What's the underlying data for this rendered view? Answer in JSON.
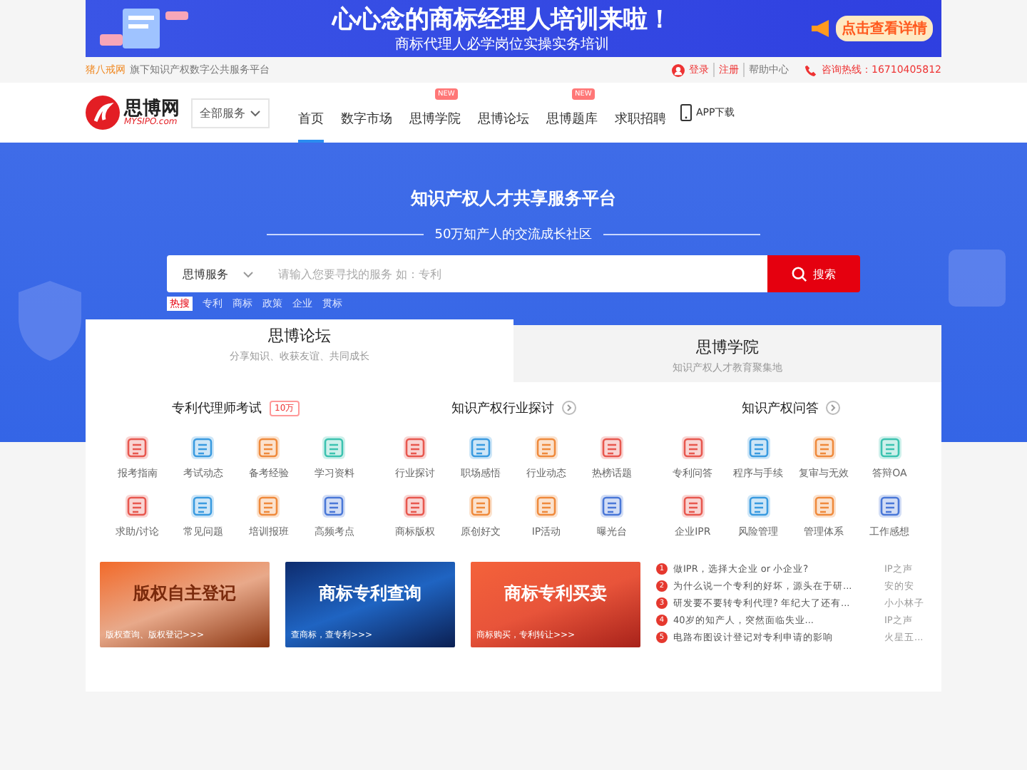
{
  "ad_banner": {
    "headline": "心心念的商标经理人培训来啦！",
    "subline": "商标代理人必学岗位实操实务培训",
    "cta": "点击查看详情"
  },
  "top_bar": {
    "brand": "猪八戒网",
    "tagline": "旗下知识产权数字公共服务平台",
    "login": "登录",
    "register": "注册",
    "help": "帮助中心",
    "hotline": "咨询热线：16710405812"
  },
  "nav": {
    "logo": "思博网",
    "logo_sub": "MYSIPO.com",
    "all_services": "全部服务",
    "items": [
      {
        "label": "首页",
        "selected": true
      },
      {
        "label": "数字市场",
        "selected": false
      },
      {
        "label": "思博学院",
        "selected": false,
        "badge": "NEW"
      },
      {
        "label": "思博论坛",
        "selected": false
      },
      {
        "label": "思博题库",
        "selected": false,
        "badge": "NEW"
      },
      {
        "label": "求职招聘",
        "selected": false
      }
    ],
    "app": "APP下载"
  },
  "hero": {
    "title": "知识产权人才共享服务平台",
    "subtitle": "50万知产人的交流成长社区",
    "search_category": "思博服务",
    "search_placeholder": "请输入您要寻找的服务 如：专利",
    "search_button": "搜索",
    "quick_links": [
      {
        "label": "热搜",
        "kind": "hot"
      },
      {
        "label": "专利",
        "kind": "link"
      },
      {
        "label": "商标",
        "kind": "link"
      },
      {
        "label": "政策",
        "kind": "link"
      },
      {
        "label": "企业",
        "kind": "link"
      },
      {
        "label": "贯标",
        "kind": "link"
      }
    ]
  },
  "tabs": [
    {
      "title": "思博论坛",
      "subtitle": "分享知识、收获友谊、共同成长",
      "selected": true
    },
    {
      "title": "思博学院",
      "subtitle": "知识产权人才教育聚集地",
      "selected": false
    }
  ],
  "sections": [
    {
      "title": "专利代理师考试",
      "tag": "10万",
      "arrow": false,
      "items": [
        {
          "label": "报考指南",
          "color": "#e8584f"
        },
        {
          "label": "考试动态",
          "color": "#3a9be0"
        },
        {
          "label": "备考经验",
          "color": "#ef8a3c"
        },
        {
          "label": "学习资料",
          "color": "#3cc3b0"
        },
        {
          "label": "求助/讨论",
          "color": "#e8584f"
        },
        {
          "label": "常见问题",
          "color": "#3a9be0"
        },
        {
          "label": "培训报班",
          "color": "#ef8a3c"
        },
        {
          "label": "高频考点",
          "color": "#4a78d8"
        }
      ]
    },
    {
      "title": "知识产权行业探讨",
      "arrow": true,
      "items": [
        {
          "label": "行业探讨",
          "color": "#e8584f"
        },
        {
          "label": "职场感悟",
          "color": "#3a9be0"
        },
        {
          "label": "行业动态",
          "color": "#ef8a3c"
        },
        {
          "label": "热榜话题",
          "color": "#e8584f"
        },
        {
          "label": "商标版权",
          "color": "#e8584f"
        },
        {
          "label": "原创好文",
          "color": "#ef8a3c"
        },
        {
          "label": "IP活动",
          "color": "#ef8a3c"
        },
        {
          "label": "曝光台",
          "color": "#4a78d8"
        }
      ]
    },
    {
      "title": "知识产权问答",
      "arrow": true,
      "items": [
        {
          "label": "专利问答",
          "color": "#e8584f"
        },
        {
          "label": "程序与手续",
          "color": "#3a9be0"
        },
        {
          "label": "复审与无效",
          "color": "#ef8a3c"
        },
        {
          "label": "答辩OA",
          "color": "#3cc3b0"
        },
        {
          "label": "企业IPR",
          "color": "#e8584f"
        },
        {
          "label": "风险管理",
          "color": "#3a9be0"
        },
        {
          "label": "管理体系",
          "color": "#ef8a3c"
        },
        {
          "label": "工作感想",
          "color": "#4a78d8"
        }
      ]
    }
  ],
  "promos": [
    {
      "title": "版权自主登记",
      "caption": "版权查询、版权登记>>>",
      "kind": "orange"
    },
    {
      "title": "商标专利查询",
      "caption": "查商标，查专利>>>",
      "kind": "blue"
    },
    {
      "title": "商标专利买卖",
      "caption": "商标购买，专利转让>>>",
      "kind": "red"
    }
  ],
  "hot_posts": [
    {
      "rank": "1",
      "title": "做IPR，选择大企业 or 小企业?",
      "author": "IP之声"
    },
    {
      "rank": "2",
      "title": "为什么说一个专利的好坏，源头在于研...",
      "author": "安的安"
    },
    {
      "rank": "3",
      "title": "研发要不要转专利代理? 年纪大了还有...",
      "author": "小小林子"
    },
    {
      "rank": "4",
      "title": "40岁的知产人，突然面临失业...",
      "author": "IP之声"
    },
    {
      "rank": "5",
      "title": "电路布图设计登记对专利申请的影响",
      "author": "火星五..."
    }
  ]
}
